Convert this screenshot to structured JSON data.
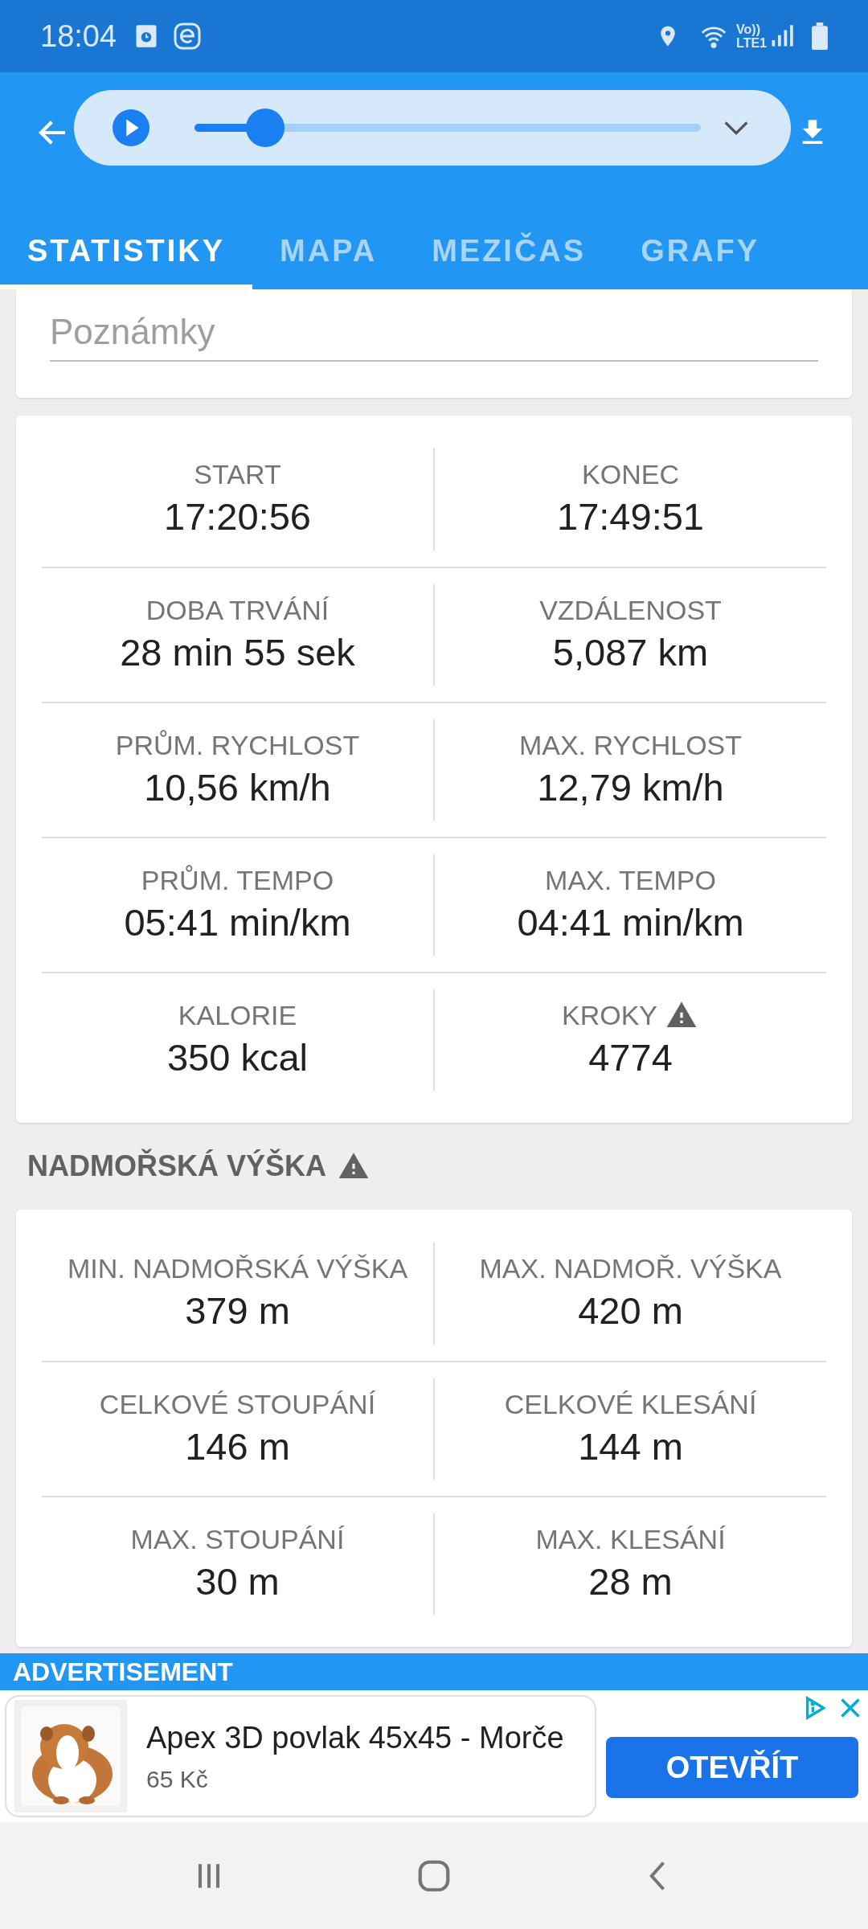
{
  "status_bar": {
    "time": "18:04",
    "network": "Vo))\nLTE1"
  },
  "player": {
    "level": 0.14
  },
  "tabs": [
    {
      "label": "STATISTIKY",
      "selected": true
    },
    {
      "label": "MAPA",
      "selected": false
    },
    {
      "label": "MEZIČAS",
      "selected": false
    },
    {
      "label": "GRAFY",
      "selected": false
    }
  ],
  "notes": {
    "placeholder": "Poznámky"
  },
  "stats": [
    {
      "label": "START",
      "value": "17:20:56",
      "warning": false
    },
    {
      "label": "KONEC",
      "value": "17:49:51",
      "warning": false
    },
    {
      "label": "DOBA TRVÁNÍ",
      "value": "28 min 55 sek",
      "warning": false
    },
    {
      "label": "VZDÁLENOST",
      "value": "5,087 km",
      "warning": false
    },
    {
      "label": "PRŮM. RYCHLOST",
      "value": "10,56 km/h",
      "warning": false
    },
    {
      "label": "MAX. RYCHLOST",
      "value": "12,79 km/h",
      "warning": false
    },
    {
      "label": "PRŮM. TEMPO",
      "value": "05:41 min/km",
      "warning": false
    },
    {
      "label": "MAX. TEMPO",
      "value": "04:41 min/km",
      "warning": false
    },
    {
      "label": "KALORIE",
      "value": "350 kcal",
      "warning": false
    },
    {
      "label": "KROKY",
      "value": "4774",
      "warning": true
    }
  ],
  "altitude": {
    "title": "NADMOŘSKÁ VÝŠKA",
    "warning": true,
    "items": [
      {
        "label": "MIN. NADMOŘSKÁ VÝŠKA",
        "value": "379 m",
        "warning": false
      },
      {
        "label": "MAX. NADMOŘ. VÝŠKA",
        "value": "420 m",
        "warning": false
      },
      {
        "label": "CELKOVÉ STOUPÁNÍ",
        "value": "146 m",
        "warning": false
      },
      {
        "label": "CELKOVÉ KLESÁNÍ",
        "value": "144 m",
        "warning": false
      },
      {
        "label": "MAX. STOUPÁNÍ",
        "value": "30 m",
        "warning": false
      },
      {
        "label": "MAX. KLESÁNÍ",
        "value": "28 m",
        "warning": false
      }
    ]
  },
  "ad": {
    "header": "ADVERTISEMENT",
    "title": "Apex 3D povlak 45x45 - Morče",
    "price": "65 Kč",
    "button": "OTEVŘÍT"
  }
}
